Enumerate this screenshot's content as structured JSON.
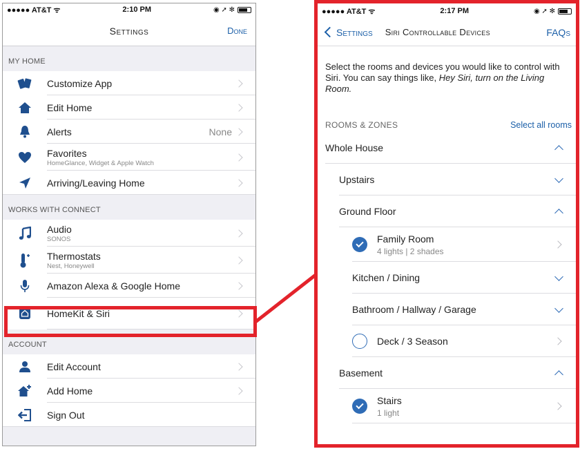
{
  "left": {
    "status": {
      "carrier": "●●●●● AT&T ᯤ",
      "time": "2:10 PM",
      "right": "◉ ➚ ✻"
    },
    "nav": {
      "title": "Settings",
      "done": "Done"
    },
    "sections": {
      "my_home": "MY HOME",
      "works_with": "WORKS WITH CONNECT",
      "account": "ACCOUNT"
    },
    "items": {
      "customize": {
        "label": "Customize App"
      },
      "edit_home": {
        "label": "Edit Home"
      },
      "alerts": {
        "label": "Alerts",
        "value": "None"
      },
      "favorites": {
        "label": "Favorites",
        "sub": "HomeGlance, Widget & Apple Watch"
      },
      "arriving": {
        "label": "Arriving/Leaving Home"
      },
      "audio": {
        "label": "Audio",
        "sub": "SONOS"
      },
      "thermostats": {
        "label": "Thermostats",
        "sub": "Nest, Honeywell"
      },
      "alexa": {
        "label": "Amazon Alexa & Google Home"
      },
      "homekit": {
        "label": "HomeKit & Siri"
      },
      "edit_account": {
        "label": "Edit Account"
      },
      "add_home": {
        "label": "Add Home"
      },
      "sign_out": {
        "label": "Sign Out"
      }
    }
  },
  "right": {
    "status": {
      "carrier": "●●●●● AT&T ᯤ",
      "time": "2:17 PM",
      "right": "◉ ➚ ✻"
    },
    "nav": {
      "back": "Settings",
      "title": "Siri Controllable Devices",
      "faqs": "FAQs"
    },
    "intro_plain": "Select the rooms and devices you would like to control with Siri. You can say things like, ",
    "intro_italic": "Hey Siri, turn on the Living Room.",
    "rooms_caption": "ROOMS & ZONES",
    "select_all": "Select all rooms",
    "rows": {
      "whole_house": "Whole House",
      "upstairs": "Upstairs",
      "ground_floor": "Ground Floor",
      "family_room": {
        "name": "Family Room",
        "sub": "4 lights | 2 shades"
      },
      "kitchen": "Kitchen / Dining",
      "bathroom": "Bathroom / Hallway / Garage",
      "deck": "Deck / 3 Season",
      "basement": "Basement",
      "stairs": {
        "name": "Stairs",
        "sub": "1 light"
      }
    }
  },
  "colors": {
    "accent": "#1b5fa8",
    "highlight": "#e3232b",
    "check": "#2f6cb6"
  }
}
